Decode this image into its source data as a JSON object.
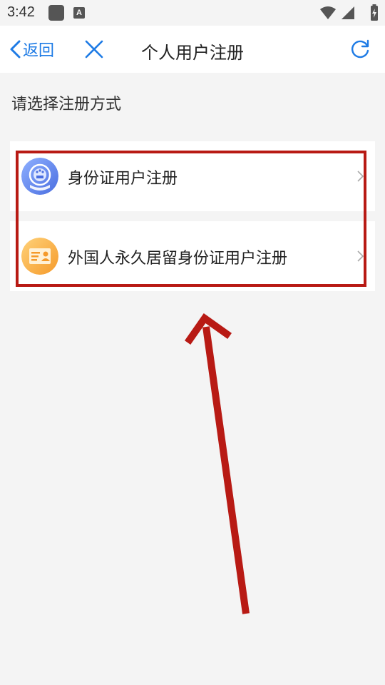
{
  "status_bar": {
    "time": "3:42",
    "notification_icons": [
      "app-notification-icon",
      "text-notification-icon"
    ],
    "notification_letter": "A",
    "system_icons": [
      "wifi-icon",
      "cellular-signal-icon",
      "battery-charging-icon"
    ]
  },
  "nav": {
    "back_label": "返回",
    "title": "个人用户注册",
    "close_icon": "close-icon",
    "refresh_icon": "refresh-icon",
    "accent_color": "#1e7be5"
  },
  "content": {
    "heading": "请选择注册方式",
    "options": [
      {
        "label": "身份证用户注册",
        "icon": "national-emblem-icon",
        "icon_color": "#5b7fe6"
      },
      {
        "label": "外国人永久居留身份证用户注册",
        "icon": "permanent-residence-card-icon",
        "icon_color": "#f5a53a"
      }
    ]
  },
  "annotation": {
    "highlight_color": "#b81a14",
    "arrow_direction": "up"
  }
}
